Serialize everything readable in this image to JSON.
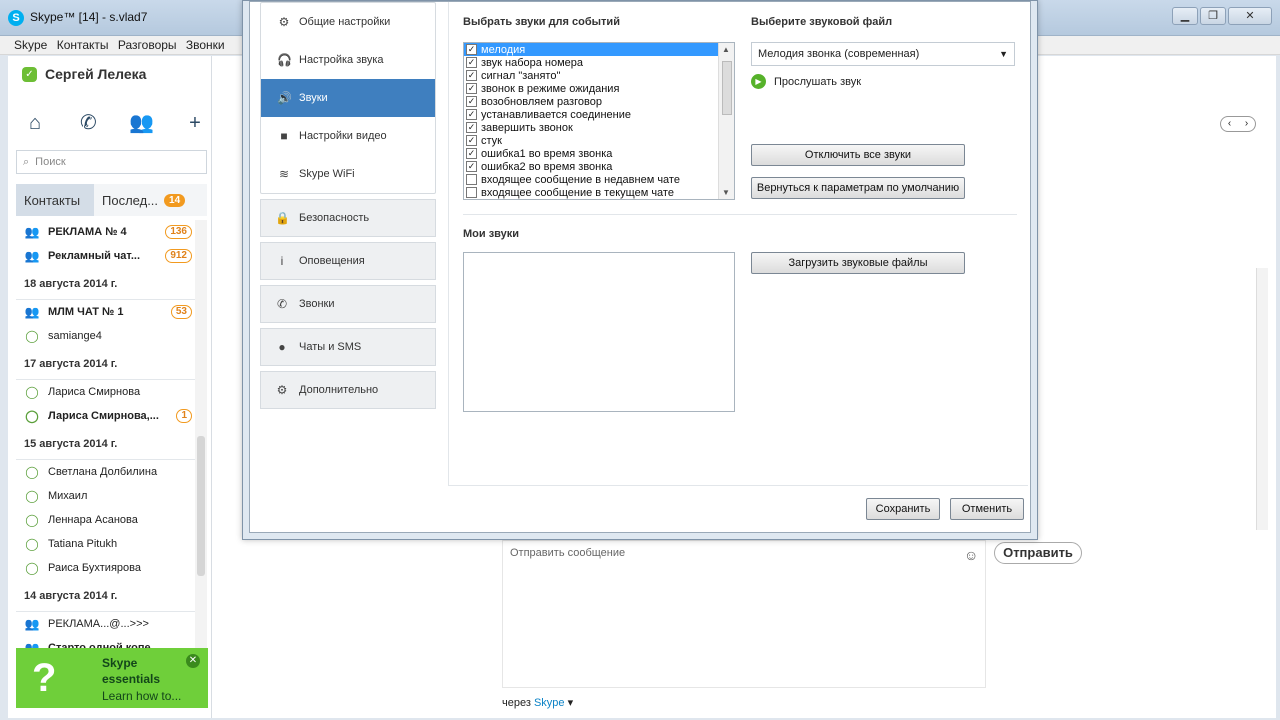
{
  "window": {
    "title": "Skype™ [14] - s.vlad7",
    "logo": "S",
    "controls": [
      "▁",
      "❐",
      "✕"
    ]
  },
  "menu": [
    "Skype",
    "Контакты",
    "Разговоры",
    "Звонки"
  ],
  "sidebar": {
    "user_name": "Сергей Лелека",
    "search_placeholder": "Поиск",
    "tab_contacts": "Контакты",
    "tab_recent": "Послед...",
    "tab_recent_badge": "14",
    "contacts": [
      {
        "type": "item",
        "name": "РЕКЛАМА № 4",
        "count": "136",
        "bold": true,
        "icon": "group-icon"
      },
      {
        "type": "item",
        "name": "Рекламный чат...",
        "count": "912",
        "bold": true,
        "icon": "group-icon"
      },
      {
        "type": "date",
        "label": "18 августа 2014 г."
      },
      {
        "type": "item",
        "name": "МЛМ ЧАТ № 1",
        "count": "53",
        "bold": true,
        "icon": "group-icon"
      },
      {
        "type": "item",
        "name": "samiange4",
        "count": "",
        "bold": false,
        "icon": "status-icon"
      },
      {
        "type": "date",
        "label": "17 августа 2014 г."
      },
      {
        "type": "item",
        "name": "Лариса Смирнова",
        "count": "",
        "bold": false,
        "icon": "status-icon"
      },
      {
        "type": "item",
        "name": "Лариса Смирнова,...",
        "count": "1",
        "bold": true,
        "icon": "status-icon"
      },
      {
        "type": "date",
        "label": "15 августа 2014 г."
      },
      {
        "type": "item",
        "name": "Светлана Долбилина",
        "count": "",
        "bold": false,
        "icon": "status-icon"
      },
      {
        "type": "item",
        "name": "Михаил",
        "count": "",
        "bold": false,
        "icon": "status-icon"
      },
      {
        "type": "item",
        "name": "Леннара  Асанова",
        "count": "",
        "bold": false,
        "icon": "status-icon"
      },
      {
        "type": "item",
        "name": "Tatiana Pitukh",
        "count": "",
        "bold": false,
        "icon": "status-icon"
      },
      {
        "type": "item",
        "name": "Раиса Бухтиярова",
        "count": "",
        "bold": false,
        "icon": "status-icon"
      },
      {
        "type": "date",
        "label": "14 августа 2014 г."
      },
      {
        "type": "item",
        "name": "РЕКЛАМА...@...>>>",
        "count": "",
        "bold": false,
        "icon": "group-icon"
      },
      {
        "type": "item",
        "name": "Старто одной копе...",
        "count": "",
        "bold": true,
        "icon": "group-icon"
      }
    ],
    "essentials": {
      "line1": "Skype",
      "line2": "essentials",
      "line3": "Learn how to..."
    }
  },
  "chat": {
    "message_placeholder": "Отправить сообщение",
    "send_label": "Отправить",
    "via_prefix": "через",
    "via_link": "Skype"
  },
  "settings": {
    "nav_sub": [
      {
        "label": "Общие настройки",
        "icon": "gear-icon",
        "active": false
      },
      {
        "label": "Настройка звука",
        "icon": "headset-icon",
        "active": false
      },
      {
        "label": "Звуки",
        "icon": "speaker-icon",
        "active": true
      },
      {
        "label": "Настройки видео",
        "icon": "camera-icon",
        "active": false
      },
      {
        "label": "Skype WiFi",
        "icon": "wifi-icon",
        "active": false
      }
    ],
    "nav_main": [
      {
        "label": "Безопасность",
        "icon": "lock-icon"
      },
      {
        "label": "Оповещения",
        "icon": "info-icon"
      },
      {
        "label": "Звонки",
        "icon": "phone-icon"
      },
      {
        "label": "Чаты и SMS",
        "icon": "chat-icon"
      },
      {
        "label": "Дополнительно",
        "icon": "gear-icon"
      }
    ],
    "events_heading": "Выбрать звуки для событий",
    "file_heading": "Выберите звуковой файл",
    "events": [
      {
        "label": "мелодия",
        "checked": true,
        "selected": true
      },
      {
        "label": "звук набора номера",
        "checked": true,
        "selected": false
      },
      {
        "label": "сигнал \"занято\"",
        "checked": true,
        "selected": false
      },
      {
        "label": "звонок в режиме ожидания",
        "checked": true,
        "selected": false
      },
      {
        "label": "возобновляем разговор",
        "checked": true,
        "selected": false
      },
      {
        "label": "устанавливается соединение",
        "checked": true,
        "selected": false
      },
      {
        "label": "завершить звонок",
        "checked": true,
        "selected": false
      },
      {
        "label": "стук",
        "checked": true,
        "selected": false
      },
      {
        "label": "ошибка1 во время звонка",
        "checked": true,
        "selected": false
      },
      {
        "label": "ошибка2 во время звонка",
        "checked": true,
        "selected": false
      },
      {
        "label": "входящее сообщение в недавнем чате",
        "checked": false,
        "selected": false
      },
      {
        "label": "входящее сообщение в текущем чате",
        "checked": false,
        "selected": false
      }
    ],
    "sound_file": "Мелодия звонка (современная)",
    "listen_label": "Прослушать звук",
    "mute_all": "Отключить все звуки",
    "reset_defaults": "Вернуться к параметрам по умолчанию",
    "my_sounds_heading": "Мои звуки",
    "upload": "Загрузить звуковые файлы",
    "save": "Сохранить",
    "cancel": "Отменить"
  }
}
